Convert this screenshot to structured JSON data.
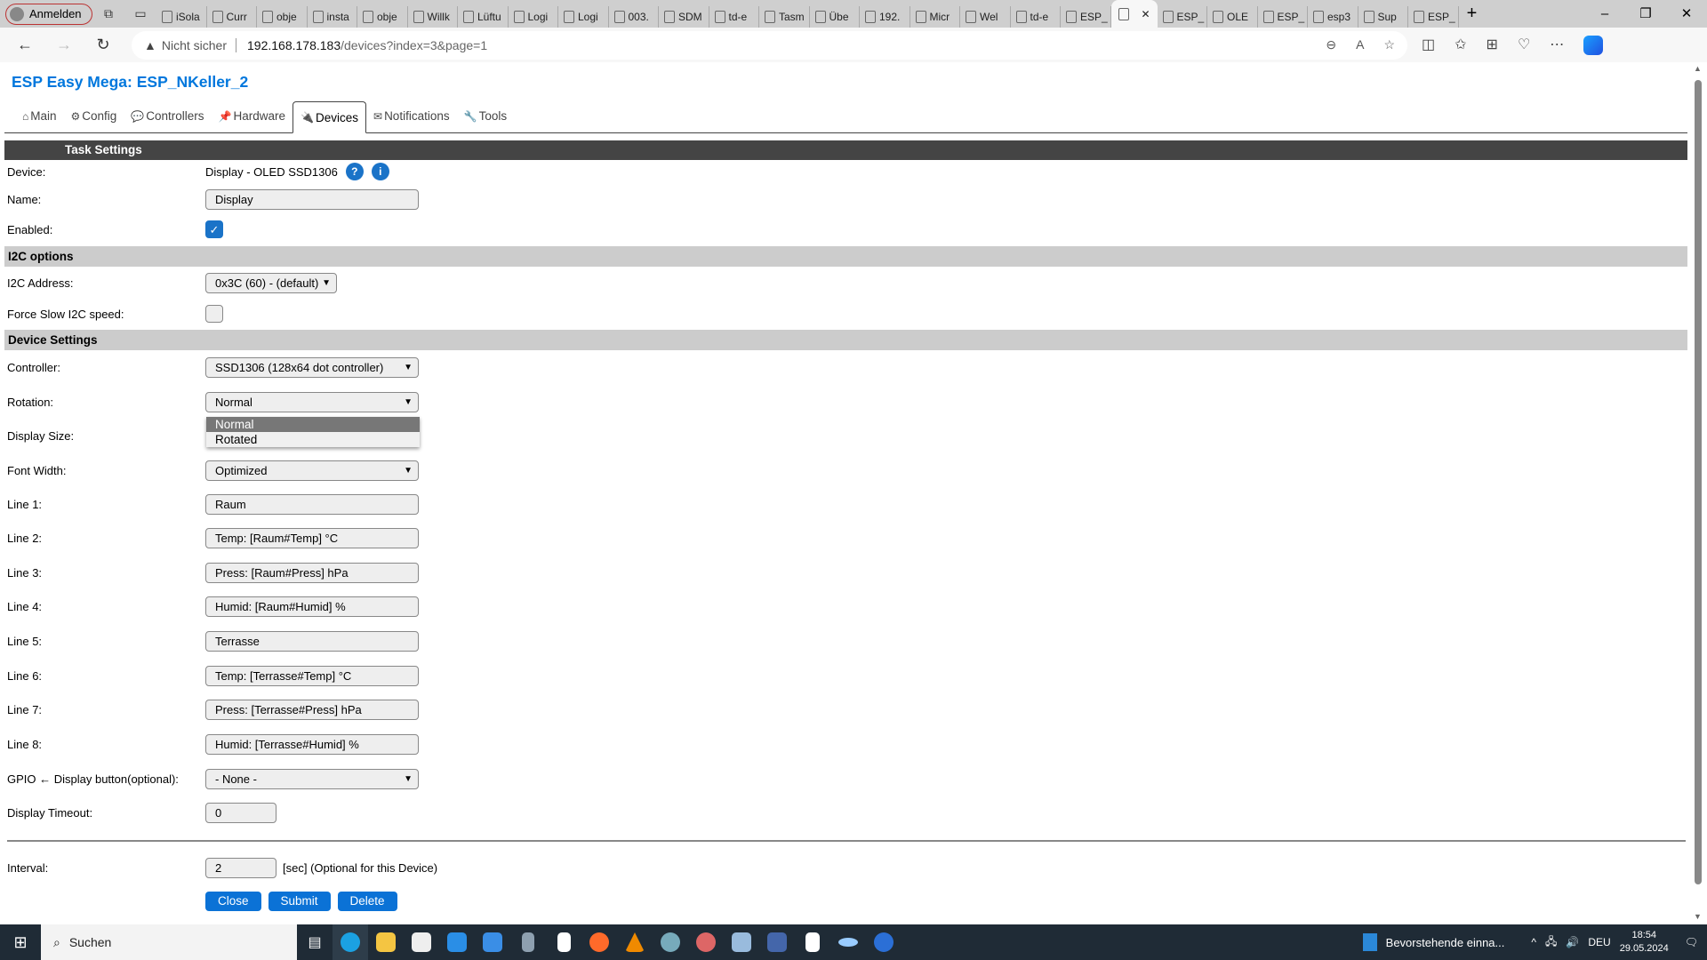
{
  "browser": {
    "profile_label": "Anmelden",
    "tabs": [
      "iSola",
      "Curr",
      "obje",
      "insta",
      "obje",
      "Willk",
      "Lüftu",
      "Logi",
      "Logi",
      "003.",
      "SDM",
      "td-e",
      "Tasm",
      "Übe",
      "192.",
      "Micr",
      "Wel",
      "td-e",
      "ESP_",
      "",
      "ESP_",
      "OLE",
      "ESP_",
      "esp3",
      "Sup",
      "ESP_"
    ],
    "active_tab_index": 19,
    "security_label": "Nicht sicher",
    "url_host": "192.168.178.183",
    "url_path": "/devices?index=3&page=1"
  },
  "page": {
    "title": "ESP Easy Mega: ESP_NKeller_2",
    "menu": [
      {
        "label": "Main",
        "icon": "⌂"
      },
      {
        "label": "Config",
        "icon": "⚙"
      },
      {
        "label": "Controllers",
        "icon": "💬"
      },
      {
        "label": "Hardware",
        "icon": "📌"
      },
      {
        "label": "Devices",
        "icon": "🔌"
      },
      {
        "label": "Notifications",
        "icon": "✉"
      },
      {
        "label": "Tools",
        "icon": "🔧"
      }
    ],
    "active_menu": "Devices",
    "task_settings": "Task Settings",
    "device_label": "Device:",
    "device_value": "Display - OLED SSD1306",
    "help_icon": "?",
    "info_icon": "i",
    "name_label": "Name:",
    "name_value": "Display",
    "enabled_label": "Enabled:",
    "enabled": true,
    "i2c_header": "I2C options",
    "i2c_address_label": "I2C Address:",
    "i2c_address_value": "0x3C (60) - (default)",
    "force_slow_label": "Force Slow I2C speed:",
    "force_slow": false,
    "device_settings_header": "Device Settings",
    "controller_label": "Controller:",
    "controller_value": "SSD1306 (128x64 dot controller)",
    "rotation_label": "Rotation:",
    "rotation_value": "Normal",
    "rotation_options": [
      "Normal",
      "Rotated"
    ],
    "display_size_label": "Display Size:",
    "font_width_label": "Font Width:",
    "font_width_value": "Optimized",
    "lines": [
      {
        "label": "Line 1:",
        "value": "Raum"
      },
      {
        "label": "Line 2:",
        "value": "Temp: [Raum#Temp] °C"
      },
      {
        "label": "Line 3:",
        "value": "Press: [Raum#Press] hPa"
      },
      {
        "label": "Line 4:",
        "value": "Humid: [Raum#Humid] %"
      },
      {
        "label": "Line 5:",
        "value": "Terrasse"
      },
      {
        "label": "Line 6:",
        "value": "Temp: [Terrasse#Temp] °C"
      },
      {
        "label": "Line 7:",
        "value": "Press: [Terrasse#Press] hPa"
      },
      {
        "label": "Line 8:",
        "value": "Humid: [Terrasse#Humid] %"
      }
    ],
    "gpio_label": "GPIO ← Display button(optional):",
    "gpio_value": "- None -",
    "timeout_label": "Display Timeout:",
    "timeout_value": "0",
    "interval_label": "Interval:",
    "interval_value": "2",
    "interval_note": "[sec] (Optional for this Device)",
    "buttons": {
      "close": "Close",
      "submit": "Submit",
      "delete": "Delete"
    },
    "accent_color": "#0077dd"
  },
  "taskbar": {
    "search_label": "Suchen",
    "notification": "Bevorstehende einna...",
    "language": "DEU",
    "time": "18:54",
    "date": "29.05.2024"
  }
}
